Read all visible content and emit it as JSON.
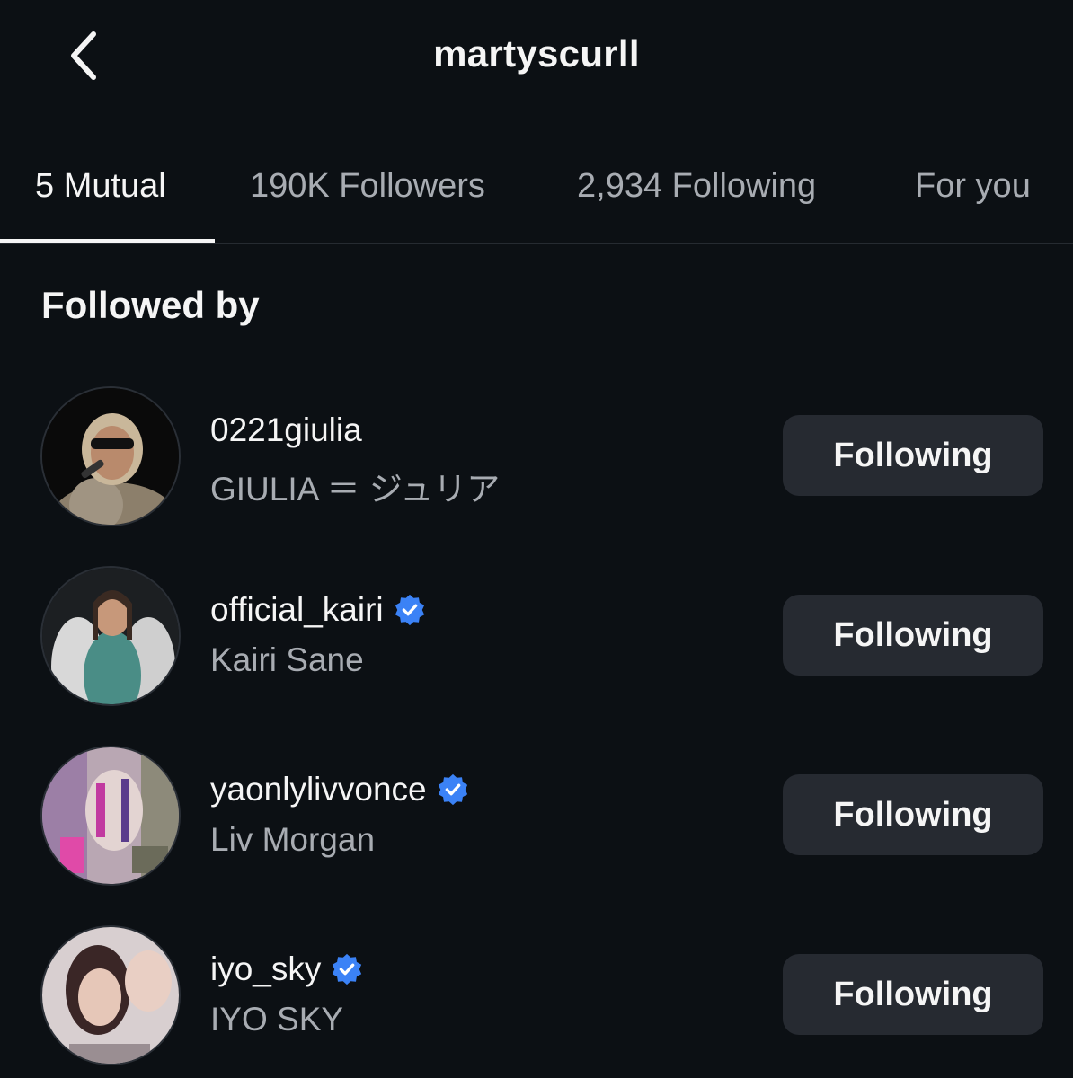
{
  "header": {
    "title": "martyscurll"
  },
  "tabs": [
    {
      "label": "5 Mutual",
      "active": true
    },
    {
      "label": "190K Followers",
      "active": false
    },
    {
      "label": "2,934 Following",
      "active": false
    },
    {
      "label": "For you",
      "active": false
    }
  ],
  "section": {
    "title": "Followed by"
  },
  "users": [
    {
      "username": "0221giulia",
      "full_name": "GIULIA ＝ ジュリア",
      "verified": false,
      "button": "Following"
    },
    {
      "username": "official_kairi",
      "full_name": "Kairi Sane",
      "verified": true,
      "button": "Following"
    },
    {
      "username": "yaonlylivvonce",
      "full_name": "Liv Morgan",
      "verified": true,
      "button": "Following"
    },
    {
      "username": "iyo_sky",
      "full_name": "IYO SKY",
      "verified": true,
      "button": "Following"
    }
  ],
  "colors": {
    "background": "#0c1014",
    "button": "#262a31",
    "verified": "#3b82f6",
    "secondary_text": "#a8acb2"
  }
}
